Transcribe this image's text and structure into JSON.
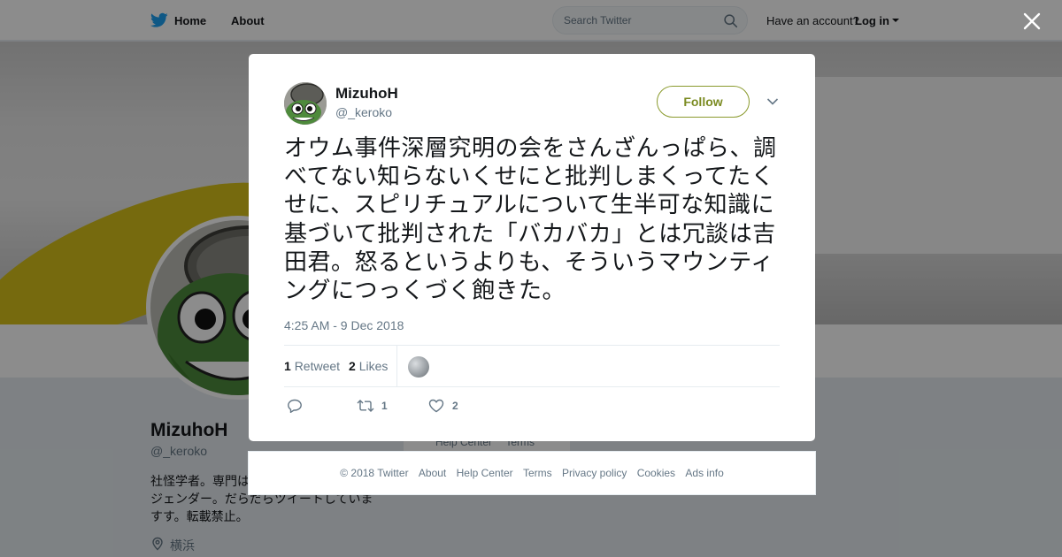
{
  "nav": {
    "home_label": "Home",
    "about_label": "About",
    "search_placeholder": "Search Twitter",
    "have_account": "Have an account?",
    "login_label": "Log in"
  },
  "profile": {
    "name": "MizuhoH",
    "handle": "@_keroko",
    "bio": "社怪学者。専門は　　　　　　　　　　　　　　ジェンダー。だらだらツイートしていますす。転載禁止。",
    "location": "横浜"
  },
  "bg_help": {
    "help_center": "Help Center",
    "terms": "Terms"
  },
  "tweet": {
    "author_name": "MizuhoH",
    "author_handle": "@_keroko",
    "follow_label": "Follow",
    "text": "オウム事件深層究明の会をさんざんっぱら、調べてない知らないくせにと批判しまくってたくせに、スピリチュアルについて生半可な知識に基づいて批判された「バカバカ」とは冗談は吉田君。怒るというよりも、そういうマウンティングにつっくづく飽きた。",
    "timestamp": "4:25 AM - 9 Dec 2018",
    "retweet_count": "1",
    "retweet_label": "Retweet",
    "like_count": "2",
    "like_label": "Likes",
    "action_retweet_count": "1",
    "action_like_count": "2"
  },
  "footer": {
    "copyright": "© 2018 Twitter",
    "about": "About",
    "help_center": "Help Center",
    "terms": "Terms",
    "privacy": "Privacy policy",
    "cookies": "Cookies",
    "ads_info": "Ads info"
  },
  "colors": {
    "twitter_blue": "#1da1f2",
    "follow_accent": "#7b8b22",
    "overlay": "rgba(0,0,0,0.45)"
  },
  "icons": [
    "twitter-bird-icon",
    "search-icon",
    "close-icon",
    "chevron-down-icon",
    "reply-icon",
    "retweet-icon",
    "heart-icon",
    "location-icon"
  ]
}
